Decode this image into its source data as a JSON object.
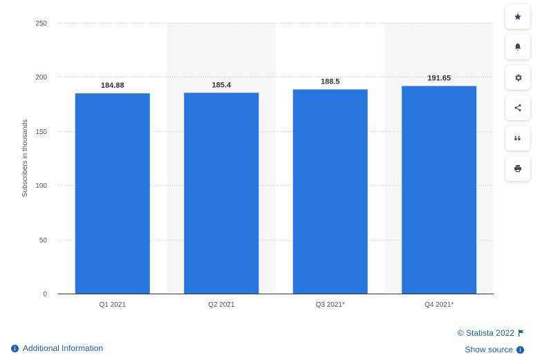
{
  "chart_data": {
    "type": "bar",
    "categories": [
      "Q1 2021",
      "Q2 2021",
      "Q3 2021*",
      "Q4 2021*"
    ],
    "values": [
      184.88,
      185.4,
      188.5,
      191.65
    ],
    "value_labels": [
      "184.88",
      "185.4",
      "188.5",
      "191.65"
    ],
    "ylabel": "Subscribers in thousands",
    "xlabel": "",
    "ylim": [
      0,
      250
    ],
    "yticks": [
      0,
      50,
      100,
      150,
      200,
      250
    ],
    "grid": true,
    "bar_color": "#2876dd",
    "alt_band_color": "#f7f7f7"
  },
  "toolbar": {
    "buttons": [
      {
        "name": "favorite-button",
        "icon": "star-icon"
      },
      {
        "name": "notification-button",
        "icon": "bell-icon"
      },
      {
        "name": "settings-button",
        "icon": "gear-icon"
      },
      {
        "name": "share-button",
        "icon": "share-icon"
      },
      {
        "name": "cite-button",
        "icon": "quote-icon"
      },
      {
        "name": "print-button",
        "icon": "print-icon"
      }
    ]
  },
  "footer": {
    "copyright": "© Statista 2022",
    "show_source": "Show source",
    "additional_info": "Additional Information"
  },
  "colors": {
    "link": "#1a5fb4",
    "axis_text": "#555555"
  }
}
